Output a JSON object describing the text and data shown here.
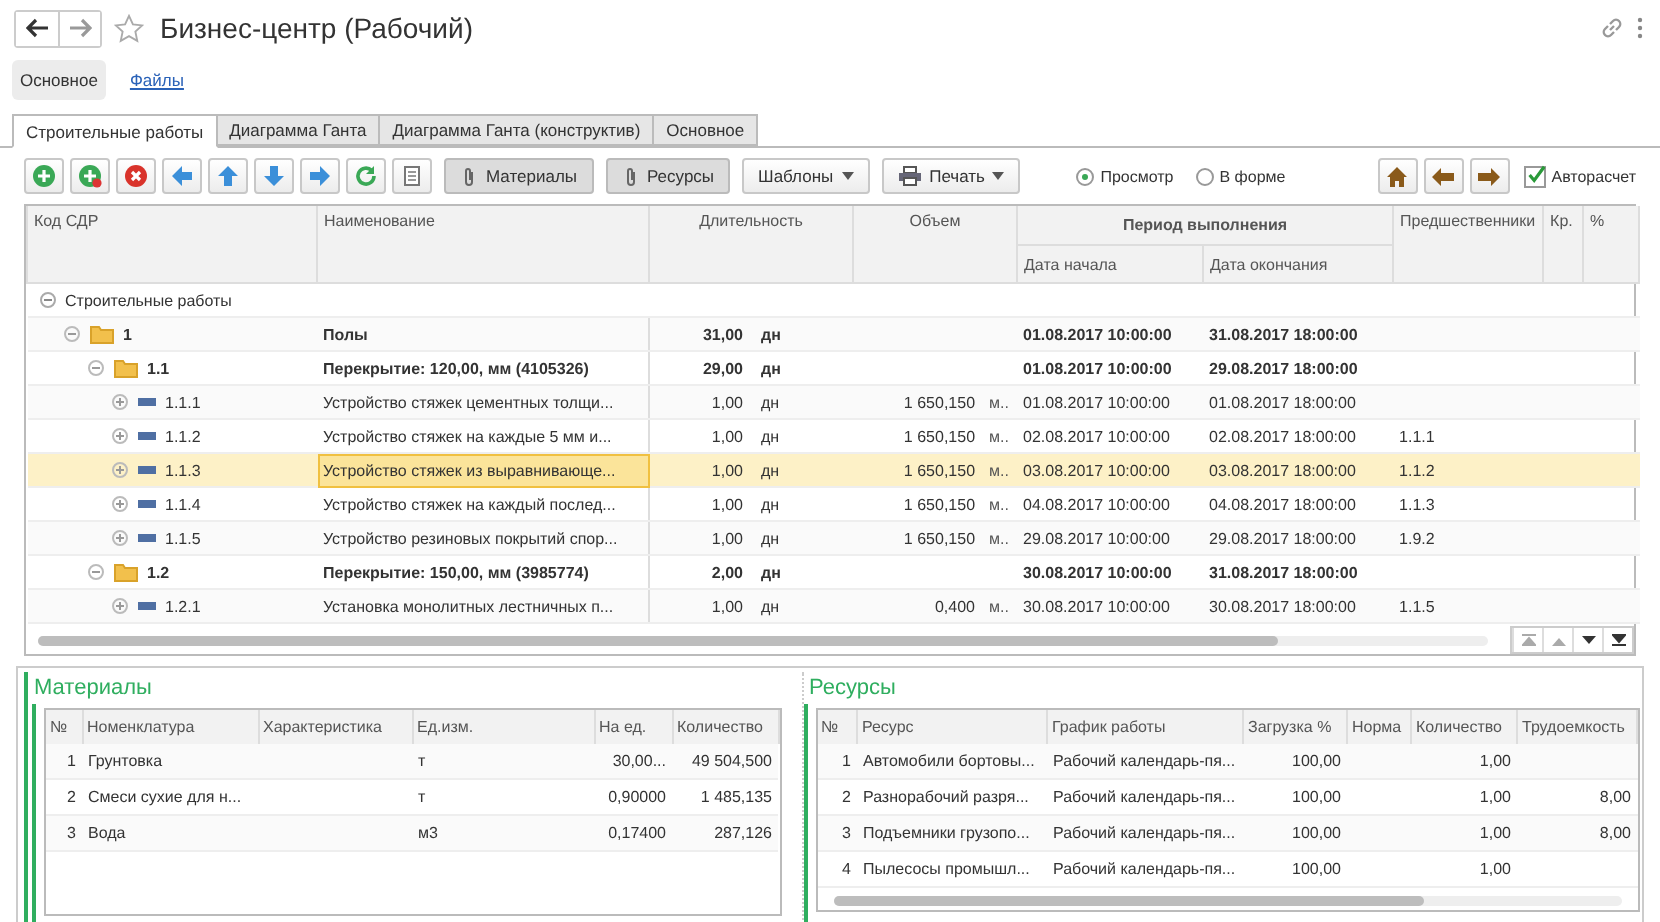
{
  "window": {
    "title": "Бизнес-центр (Рабочий)"
  },
  "sections": [
    {
      "label": "Основное",
      "selected": true
    },
    {
      "label": "Файлы",
      "selected": false
    }
  ],
  "tabs": [
    {
      "label": "Строительные работы",
      "selected": true
    },
    {
      "label": "Диаграмма Ганта",
      "selected": false
    },
    {
      "label": "Диаграмма Ганта (конструктив)",
      "selected": false
    },
    {
      "label": "Основное",
      "selected": false
    }
  ],
  "toolbar": {
    "buttons": [
      {
        "label": "Материалы",
        "pressed": true,
        "kind": "attachment"
      },
      {
        "label": "Ресурсы",
        "pressed": true,
        "kind": "attachment"
      },
      {
        "label": "Шаблоны",
        "pressed": false,
        "kind": "menu"
      },
      {
        "label": "Печать",
        "pressed": false,
        "kind": "print"
      }
    ],
    "modes": [
      {
        "label": "Просмотр",
        "selected": true
      },
      {
        "label": "В форме",
        "selected": false
      }
    ],
    "autocalc": {
      "label": "Авторасчет",
      "checked": true
    }
  },
  "grid": {
    "columns": {
      "code": "Код СДР",
      "name": "Наименование",
      "duration": "Длительность",
      "volume": "Объем",
      "period": "Период выполнения",
      "start": "Дата начала",
      "end": "Дата окончания",
      "predecessors": "Предшественники",
      "kr": "Кр.",
      "percent": "%"
    },
    "rows": [
      {
        "kind": "root",
        "code": "Строительные работы",
        "expanded": true,
        "selected": false,
        "children": [
          {
            "kind": "folder",
            "code": "1",
            "name": "Полы",
            "duration": "31,00",
            "duration_unit": "дн",
            "start": "01.08.2017 10:00:00",
            "end": "31.08.2017 18:00:00",
            "expanded": true,
            "selected": false,
            "children": [
              {
                "kind": "folder",
                "code": "1.1",
                "name": "Перекрытие: 120,00, мм (4105326)",
                "duration": "29,00",
                "duration_unit": "дн",
                "start": "01.08.2017 10:00:00",
                "end": "29.08.2017 18:00:00",
                "expanded": true,
                "selected": false,
                "children": [
                  {
                    "kind": "task",
                    "code": "1.1.1",
                    "name": "Устройство стяжек цементных толщи...",
                    "duration": "1,00",
                    "duration_unit": "дн",
                    "volume": "1 650,150",
                    "volume_unit": "м..",
                    "start": "01.08.2017 10:00:00",
                    "end": "01.08.2017 18:00:00",
                    "expanded": false,
                    "selected": false
                  },
                  {
                    "kind": "task",
                    "code": "1.1.2",
                    "name": "Устройство стяжек на каждые 5 мм и...",
                    "duration": "1,00",
                    "duration_unit": "дн",
                    "volume": "1 650,150",
                    "volume_unit": "м..",
                    "start": "02.08.2017 10:00:00",
                    "end": "02.08.2017 18:00:00",
                    "predecessors": "1.1.1",
                    "expanded": false,
                    "selected": false
                  },
                  {
                    "kind": "task",
                    "code": "1.1.3",
                    "name": "Устройство стяжек из выравнивающе...",
                    "duration": "1,00",
                    "duration_unit": "дн",
                    "volume": "1 650,150",
                    "volume_unit": "м..",
                    "start": "03.08.2017 10:00:00",
                    "end": "03.08.2017 18:00:00",
                    "predecessors": "1.1.2",
                    "expanded": false,
                    "selected": true
                  },
                  {
                    "kind": "task",
                    "code": "1.1.4",
                    "name": "Устройство стяжек на каждый послед...",
                    "duration": "1,00",
                    "duration_unit": "дн",
                    "volume": "1 650,150",
                    "volume_unit": "м..",
                    "start": "04.08.2017 10:00:00",
                    "end": "04.08.2017 18:00:00",
                    "predecessors": "1.1.3",
                    "expanded": false,
                    "selected": false
                  },
                  {
                    "kind": "task",
                    "code": "1.1.5",
                    "name": "Устройство резиновых покрытий спор...",
                    "duration": "1,00",
                    "duration_unit": "дн",
                    "volume": "1 650,150",
                    "volume_unit": "м..",
                    "start": "29.08.2017 10:00:00",
                    "end": "29.08.2017 18:00:00",
                    "predecessors": "1.9.2",
                    "expanded": false,
                    "selected": false
                  }
                ]
              },
              {
                "kind": "folder",
                "code": "1.2",
                "name": "Перекрытие: 150,00, мм (3985774)",
                "duration": "2,00",
                "duration_unit": "дн",
                "start": "30.08.2017 10:00:00",
                "end": "31.08.2017 18:00:00",
                "expanded": true,
                "selected": false,
                "children": [
                  {
                    "kind": "task",
                    "code": "1.2.1",
                    "name": "Установка монолитных лестничных п...",
                    "duration": "1,00",
                    "duration_unit": "дн",
                    "volume": "0,400",
                    "volume_unit": "м..",
                    "start": "30.08.2017 10:00:00",
                    "end": "30.08.2017 18:00:00",
                    "predecessors": "1.1.5",
                    "expanded": false,
                    "selected": false
                  }
                ]
              }
            ]
          }
        ]
      }
    ]
  },
  "materials": {
    "title": "Материалы",
    "columns": [
      "№",
      "Номенклатура",
      "Характеристика",
      "Ед.изм.",
      "На ед.",
      "Количество"
    ],
    "rows": [
      [
        "1",
        "Грунтовка",
        "",
        "т",
        "30,00...",
        "49 504,500"
      ],
      [
        "2",
        "Смеси сухие для н...",
        "",
        "т",
        "0,90000",
        "1 485,135"
      ],
      [
        "3",
        "Вода",
        "",
        "м3",
        "0,17400",
        "287,126"
      ]
    ]
  },
  "resources": {
    "title": "Ресурсы",
    "columns": [
      "№",
      "Ресурс",
      "График работы",
      "Загрузка %",
      "Норма",
      "Количество",
      "Трудоемкость"
    ],
    "rows": [
      [
        "1",
        "Автомобили бортовы...",
        "Рабочий календарь-пя...",
        "100,00",
        "",
        "1,00",
        ""
      ],
      [
        "2",
        "Разнорабочий разря...",
        "Рабочий календарь-пя...",
        "100,00",
        "",
        "1,00",
        "8,00"
      ],
      [
        "3",
        "Подъемники грузопо...",
        "Рабочий календарь-пя...",
        "100,00",
        "",
        "1,00",
        "8,00"
      ],
      [
        "4",
        "Пылесосы промышл...",
        "Рабочий календарь-пя...",
        "100,00",
        "",
        "1,00",
        ""
      ]
    ]
  }
}
